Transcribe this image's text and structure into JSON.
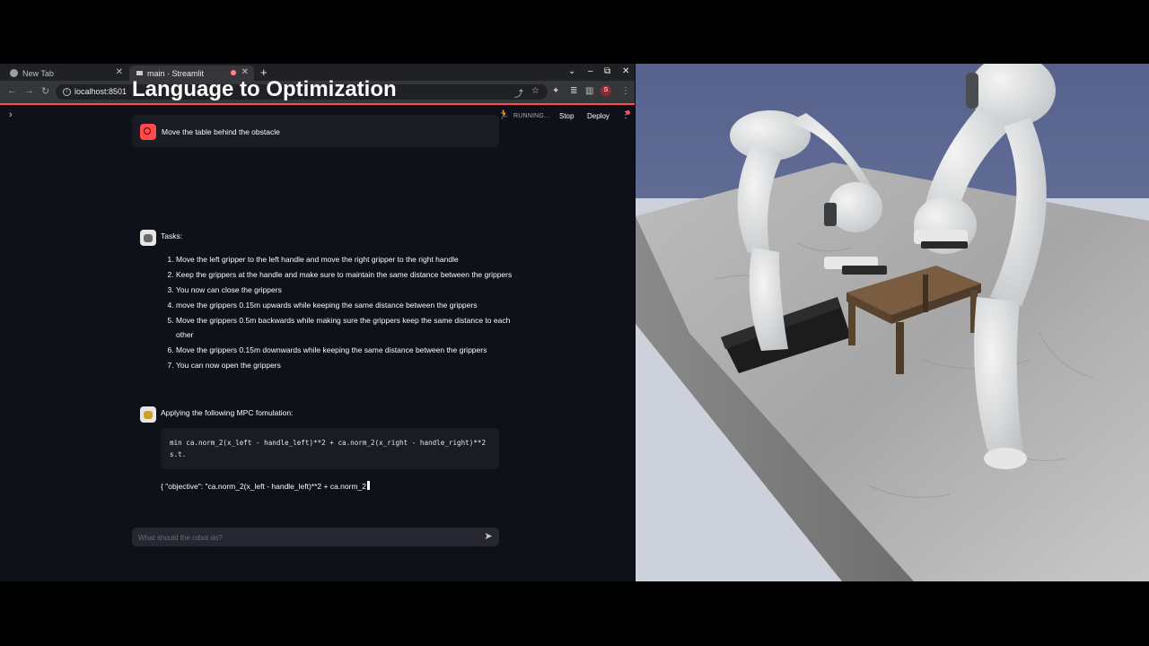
{
  "browser": {
    "tabs": [
      {
        "label": "New Tab",
        "active": false
      },
      {
        "label": "main · Streamlit",
        "active": true
      }
    ],
    "url": "localhost:8501",
    "profile_initial": "S"
  },
  "header": {
    "status": "RUNNING...",
    "stop_label": "Stop",
    "deploy_label": "Deploy"
  },
  "main": {
    "title": "Language to Optimization",
    "user_message": "Move the table behind the obstacle",
    "tasks_label": "Tasks:",
    "tasks": [
      "Move the left gripper to the left handle and move the right gripper to the right handle",
      "Keep the grippers at the handle and make sure to maintain the same distance between the grippers",
      "You now can close the grippers",
      "move the grippers 0.15m upwards while keeping the same distance between the grippers",
      "Move the grippers 0.5m backwards while making sure the grippers keep the same distance to each other",
      "Move the grippers 0.15m downwards while keeping the same distance between the grippers",
      "You can now open the grippers"
    ],
    "mpc_label": "Applying the following MPC fomulation:",
    "code_lines": "min ca.norm_2(x_left - handle_left)**2 + ca.norm_2(x_right - handle_right)**2\ns.t.",
    "streaming_text": "{ \"objective\": \"ca.norm_2(x_left - handle_left)**2 + ca.norm_2",
    "input_placeholder": "What should the robot do?"
  },
  "colors": {
    "accent": "#ff4b4b",
    "app_background": "#0e1117",
    "message_background": "#1a1c24",
    "floor": "#a9a9a9",
    "table_wood": "#6e543a",
    "obstacle": "#1c1c1c",
    "sky": "#5a6691"
  }
}
